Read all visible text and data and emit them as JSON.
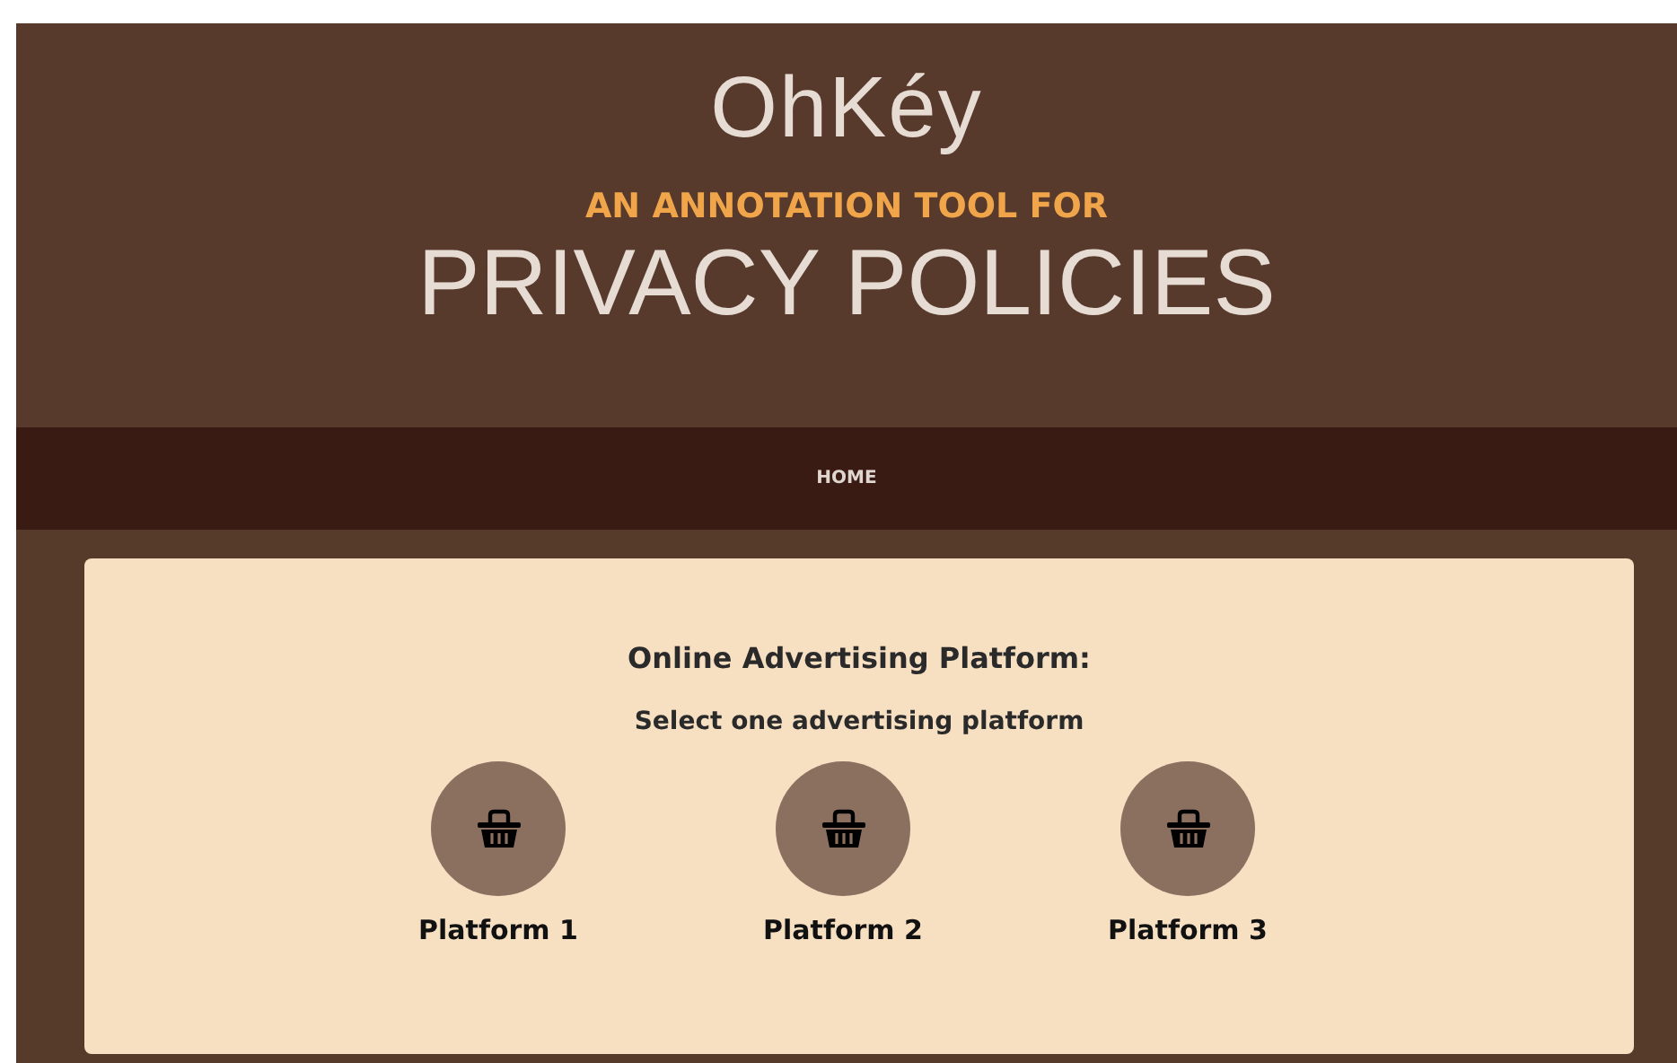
{
  "header": {
    "logo": "OhKéy",
    "tagline": "AN ANNOTATION TOOL FOR",
    "title": "PRIVACY POLICIES"
  },
  "nav": {
    "items": [
      {
        "label": "HOME"
      }
    ]
  },
  "card": {
    "heading": "Online Advertising Platform:",
    "subheading": "Select one advertising platform",
    "platforms": [
      {
        "label": "Platform 1"
      },
      {
        "label": "Platform 2"
      },
      {
        "label": "Platform 3"
      }
    ]
  }
}
